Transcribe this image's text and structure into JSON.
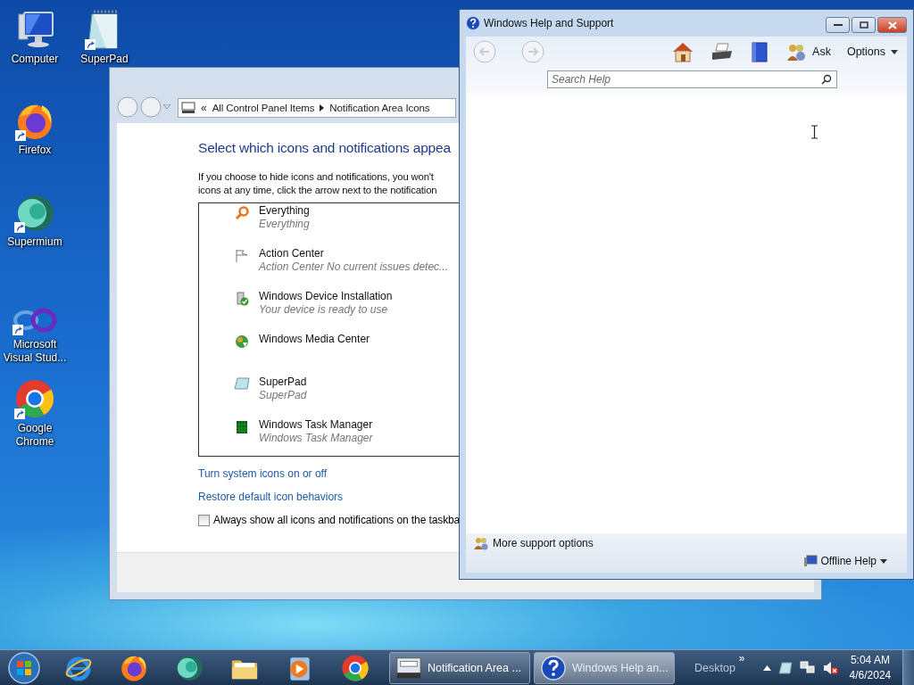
{
  "desktop_icons": [
    {
      "kind": "computer",
      "label": "Computer",
      "shortcut": false
    },
    {
      "kind": "notepad",
      "label": "SuperPad",
      "shortcut": true
    },
    {
      "kind": "firefox",
      "label": "Firefox",
      "shortcut": true
    },
    {
      "kind": "supermium",
      "label": "Supermium",
      "shortcut": true
    },
    {
      "kind": "infinity",
      "label": "Microsoft Visual Stud...",
      "shortcut": true
    },
    {
      "kind": "chrome",
      "label": "Google Chrome",
      "shortcut": true
    }
  ],
  "control_panel": {
    "address_chevron": "«",
    "address": [
      "All Control Panel Items",
      "Notification Area Icons"
    ],
    "heading": "Select which icons and notifications appea",
    "description": [
      "If you choose to hide icons and notifications, you won't",
      "icons at any time, click the arrow next to the notification"
    ],
    "icons": [
      {
        "kind": "search",
        "name": "Everything",
        "behavior": "Everything"
      },
      {
        "kind": "flag",
        "name": "Action Center",
        "behavior": "Action Center  No current issues detec..."
      },
      {
        "kind": "device",
        "name": "Windows Device Installation",
        "behavior": "Your device is ready to use"
      },
      {
        "kind": "media",
        "name": "Windows Media Center"
      },
      {
        "kind": "notepad",
        "name": "SuperPad",
        "behavior": "SuperPad"
      },
      {
        "kind": "taskmgr",
        "name": "Windows Task Manager",
        "behavior": "Windows Task Manager"
      }
    ],
    "links": [
      "Turn system icons on or off",
      "Restore default icon behaviors"
    ],
    "checkbox": {
      "label": "Always show all icons and notifications on the taskba",
      "checked": false
    }
  },
  "help_window": {
    "title": "Windows Help and Support",
    "ask": "Ask",
    "options": "Options",
    "search": {
      "placeholder": "Search Help"
    },
    "support": "More support options",
    "offline": "Offline Help"
  },
  "taskbar": {
    "tasks": [
      {
        "kind": "controlpanel",
        "label": "Notification Area ...",
        "selected": false
      },
      {
        "kind": "help",
        "label": "Windows Help an...",
        "selected": true
      }
    ],
    "toolbar": "Desktop",
    "chevron": "»",
    "time": "5:04 AM",
    "date": "4/6/2024"
  }
}
